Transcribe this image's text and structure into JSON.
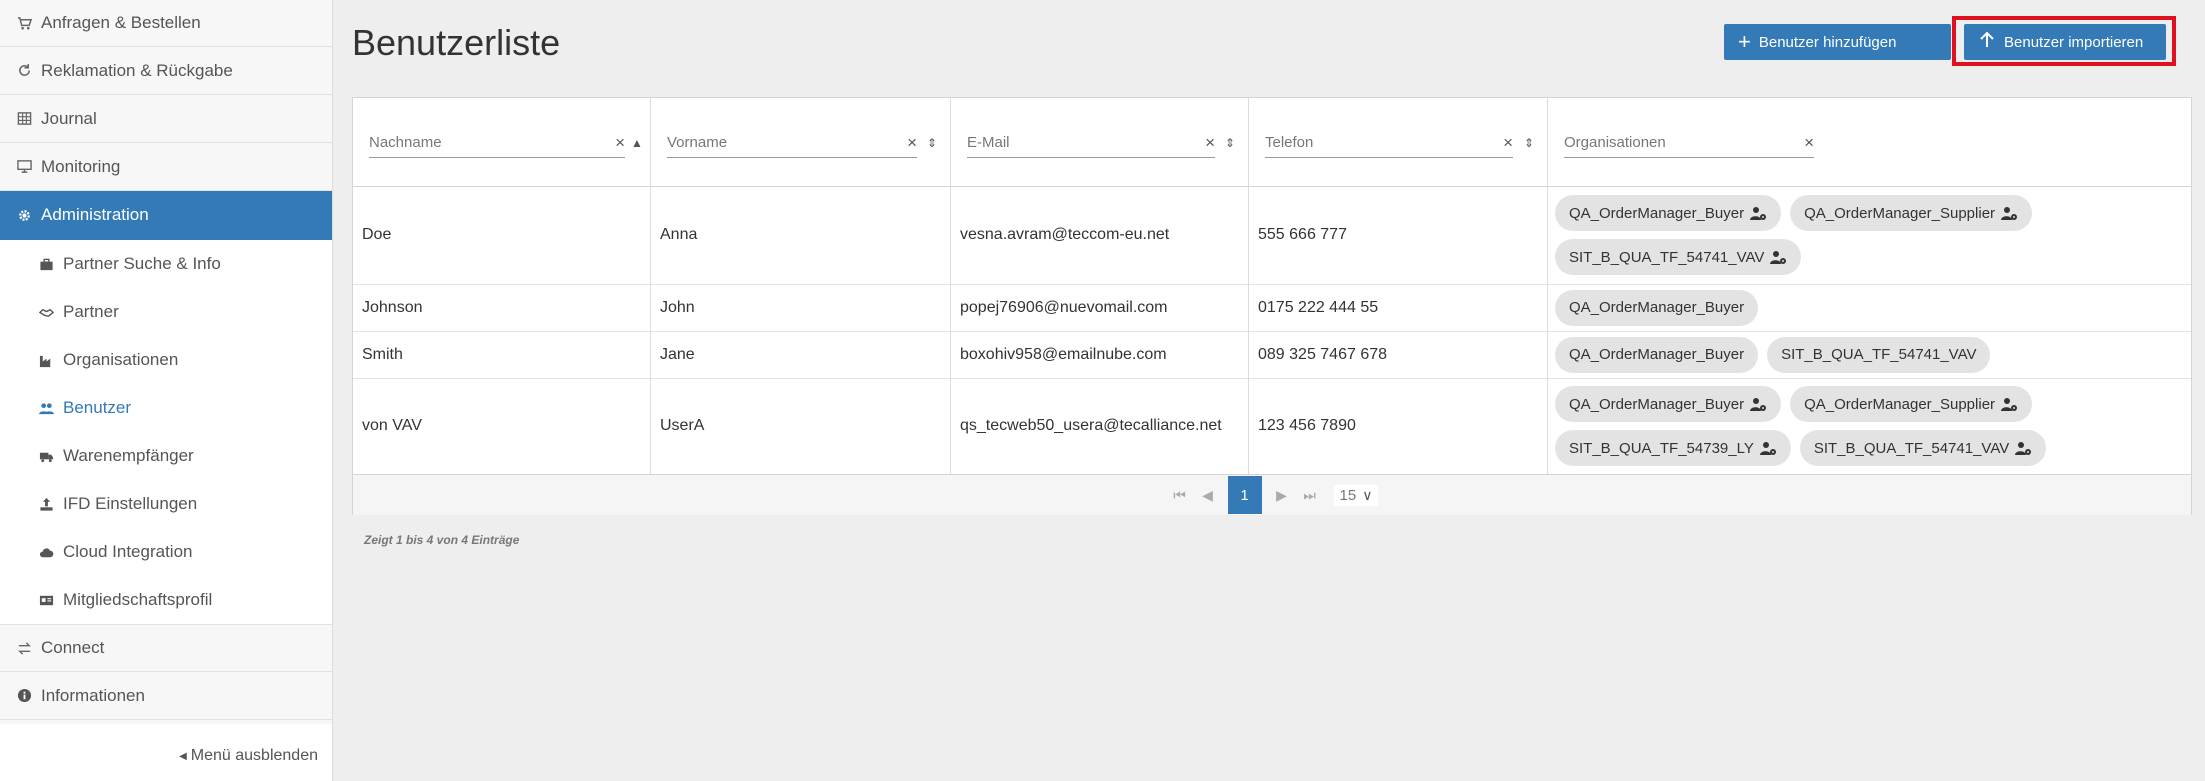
{
  "sidebar": {
    "items": [
      {
        "label": "Anfragen & Bestellen",
        "icon": "cart-icon"
      },
      {
        "label": "Reklamation & Rückgabe",
        "icon": "refresh-icon"
      },
      {
        "label": "Journal",
        "icon": "table-icon"
      },
      {
        "label": "Monitoring",
        "icon": "monitor-icon"
      },
      {
        "label": "Administration",
        "icon": "gear-icon",
        "active": true
      }
    ],
    "sub_items": [
      {
        "label": "Partner Suche & Info",
        "icon": "briefcase-icon"
      },
      {
        "label": "Partner",
        "icon": "handshake-icon"
      },
      {
        "label": "Organisationen",
        "icon": "industry-icon"
      },
      {
        "label": "Benutzer",
        "icon": "users-icon",
        "selected": true
      },
      {
        "label": "Warenempfänger",
        "icon": "truck-icon"
      },
      {
        "label": "IFD Einstellungen",
        "icon": "upload-icon"
      },
      {
        "label": "Cloud Integration",
        "icon": "cloud-icon"
      },
      {
        "label": "Mitgliedschaftsprofil",
        "icon": "id-card-icon"
      }
    ],
    "bottom_items": [
      {
        "label": "Connect",
        "icon": "exchange-icon"
      },
      {
        "label": "Informationen",
        "icon": "info-icon"
      }
    ],
    "collapse_label": "Menü ausblenden"
  },
  "page": {
    "title": "Benutzerliste",
    "add_button": "Benutzer hinzufügen",
    "import_button": "Benutzer importieren"
  },
  "table": {
    "filters": [
      "Nachname",
      "Vorname",
      "E-Mail",
      "Telefon",
      "Organisationen"
    ],
    "clear_symbol": "×",
    "sort_asc_symbol": "▲",
    "sort_both_symbol": "⇕",
    "rows": [
      {
        "nachname": "Doe",
        "vorname": "Anna",
        "email": "vesna.avram@teccom-eu.net",
        "telefon": "555 666 777",
        "orgs": [
          {
            "name": "QA_OrderManager_Buyer",
            "icon": true
          },
          {
            "name": "QA_OrderManager_Supplier",
            "icon": true
          },
          {
            "name": "SIT_B_QUA_TF_54741_VAV",
            "icon": true
          }
        ]
      },
      {
        "nachname": "Johnson",
        "vorname": "John",
        "email": "popej76906@nuevomail.com",
        "telefon": "0175 222 444 55",
        "orgs": [
          {
            "name": "QA_OrderManager_Buyer",
            "icon": false
          }
        ]
      },
      {
        "nachname": "Smith",
        "vorname": "Jane",
        "email": "boxohiv958@emailnube.com",
        "telefon": "089 325 7467 678",
        "orgs": [
          {
            "name": "QA_OrderManager_Buyer",
            "icon": false
          },
          {
            "name": "SIT_B_QUA_TF_54741_VAV",
            "icon": false
          }
        ]
      },
      {
        "nachname": "von VAV",
        "vorname": "UserA",
        "email": "qs_tecweb50_usera@tecalliance.net",
        "telefon": "123 456 7890",
        "orgs": [
          {
            "name": "QA_OrderManager_Buyer",
            "icon": true
          },
          {
            "name": "QA_OrderManager_Supplier",
            "icon": true
          },
          {
            "name": "SIT_B_QUA_TF_54739_LY",
            "icon": true
          },
          {
            "name": "SIT_B_QUA_TF_54741_VAV",
            "icon": true
          }
        ]
      }
    ]
  },
  "pager": {
    "first": "⏮",
    "prev": "◀",
    "current_page": "1",
    "next": "▶",
    "last": "⏭",
    "page_size": "15",
    "chevron": "∨"
  },
  "info_text": "Zeigt 1 bis 4 von 4 Einträge",
  "colors": {
    "accent": "#337ab7",
    "highlight": "#e0101e"
  }
}
